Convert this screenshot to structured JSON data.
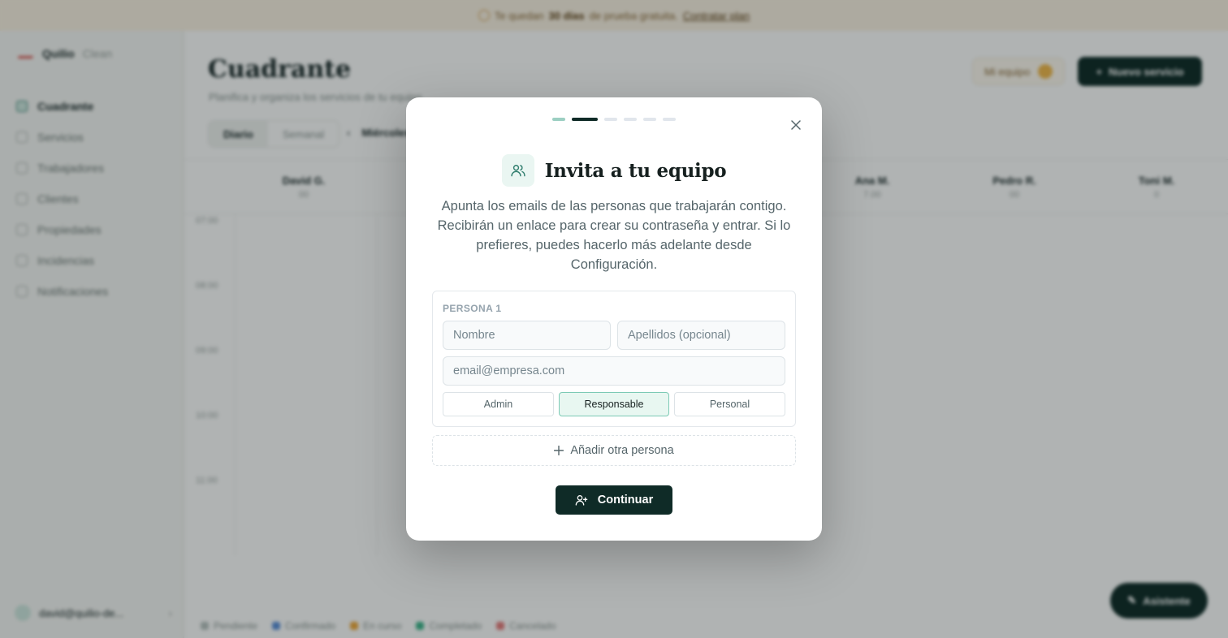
{
  "banner": {
    "pre": "Te quedan",
    "days": "30 días",
    "mid": "de prueba gratuita.",
    "link": "Contratar plan"
  },
  "sidebar": {
    "brand_name": "Quilio",
    "brand_sub": "Clean",
    "items": [
      {
        "label": "Cuadrante",
        "icon": "grid-icon"
      },
      {
        "label": "Servicios",
        "icon": "broom-icon"
      },
      {
        "label": "Trabajadores",
        "icon": "users-icon"
      },
      {
        "label": "Clientes",
        "icon": "user-icon"
      },
      {
        "label": "Propiedades",
        "icon": "building-icon"
      },
      {
        "label": "Incidencias",
        "icon": "alert-icon"
      },
      {
        "label": "Notificaciones",
        "icon": "bell-icon"
      }
    ],
    "user": "david@quilio-de..."
  },
  "main": {
    "title": "Cuadrante",
    "subtitle": "Planifica y organiza los servicios de tu equipo",
    "team_button": "Mi equipo",
    "new_button": "Nuevo servicio",
    "views": [
      "Diario",
      "Semanal"
    ],
    "date": "Miércoles",
    "columns": [
      {
        "name": "David G.",
        "sub": "00"
      },
      {
        "name": "Ana M.",
        "sub": "7.00"
      },
      {
        "name": "Pedro R.",
        "sub": "00"
      },
      {
        "name": "Toni M.",
        "sub": "0"
      }
    ],
    "hours": [
      "07:00",
      "08:00",
      "09:00",
      "10:00",
      "11:00"
    ],
    "legend": [
      "Pendiente",
      "Confirmado",
      "En curso",
      "Completado",
      "Cancelado"
    ],
    "assistant": "Asistente"
  },
  "modal": {
    "steps": [
      "done",
      "current",
      "todo",
      "todo",
      "todo",
      "todo"
    ],
    "title": "Invita a tu equipo",
    "description": "Apunta los emails de las personas que trabajarán contigo. Recibirán un enlace para crear su contraseña y entrar. Si lo prefieres, puedes hacerlo más adelante desde Configuración.",
    "person_label": "PERSONA 1",
    "name_placeholder": "Nombre",
    "lastname_placeholder": "Apellidos (opcional)",
    "email_placeholder": "email@empresa.com",
    "roles": [
      "Admin",
      "Responsable",
      "Personal"
    ],
    "selected_role": "Responsable",
    "add_person": "Añadir otra persona",
    "continue": "Continuar",
    "colors": {
      "primary": "#0f2b27",
      "accent": "#7ccab5",
      "selected_bg": "#e8f7f1"
    }
  }
}
